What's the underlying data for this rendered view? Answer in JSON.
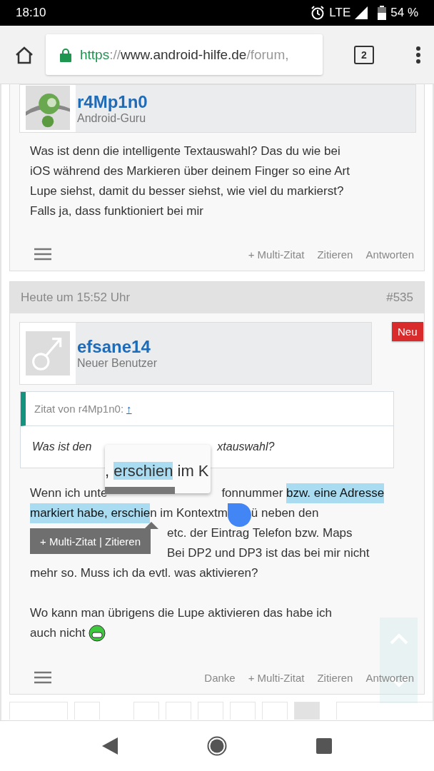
{
  "status_bar": {
    "time": "18:10",
    "network": "LTE",
    "battery": "54 %"
  },
  "browser": {
    "url": {
      "scheme": "https",
      "separator": "://",
      "host": "www.android-hilfe.de",
      "path": "/forum,"
    },
    "tab_count": "2"
  },
  "posts": [
    {
      "author": {
        "name": "r4Mp1n0",
        "rank": "Android-Guru"
      },
      "body": [
        [
          [
            {
              "kind": "text",
              "text": "Was ist denn die intelligente Textauswahl? Das du wie bei",
              "highlighted": false
            }
          ],
          [
            {
              "kind": "text",
              "text": "iOS während des Markieren über deinem Finger so eine Art",
              "highlighted": false
            }
          ],
          [
            {
              "kind": "text",
              "text": "Lupe siehst, damit du besser siehst, wie viel du markierst?",
              "highlighted": false
            }
          ],
          [
            {
              "kind": "text",
              "text": "Falls ja, dass funktioniert bei mir",
              "highlighted": false
            }
          ]
        ]
      ],
      "actions": [
        "+ Multi-Zitat",
        "Zitieren",
        "Antworten"
      ]
    },
    {
      "date": "Heute um 15:52 Uhr",
      "number": "#535",
      "badge": "Neu",
      "author": {
        "name": "efsane14",
        "rank": "Neuer Benutzer"
      },
      "quote": {
        "label": "Zitat von r4Mp1n0:",
        "link": "↑",
        "text": [
          "Was ist den",
          "xtauswahl?"
        ]
      },
      "body": [
        [
          [
            {
              "kind": "text",
              "text": "Wenn ich unte",
              "highlighted": false
            },
            {
              "kind": "lens"
            },
            {
              "kind": "text",
              "text": "fonnummer ",
              "highlighted": false
            },
            {
              "kind": "text",
              "text": "bzw. eine Adresse",
              "highlighted": true
            }
          ],
          [
            {
              "kind": "text",
              "text": "markiert habe, erschie",
              "highlighted": true
            },
            {
              "kind": "text",
              "text": "n im Kontextm",
              "highlighted": false
            },
            {
              "kind": "handle"
            },
            {
              "kind": "text",
              "text": "ü neben den",
              "highlighted": false
            }
          ],
          [
            {
              "kind": "bar"
            },
            {
              "kind": "text",
              "text": "etc. der Eintrag Telefon bzw. Maps",
              "highlighted": false
            }
          ],
          [
            {
              "kind": "bar"
            },
            {
              "kind": "text",
              "text": "Bei DP2 und DP3 ist das bei mir nicht",
              "highlighted": false
            }
          ],
          [
            {
              "kind": "text",
              "text": "mehr so. Muss ich da evtl. was aktivieren?",
              "highlighted": false
            }
          ]
        ],
        [
          [
            {
              "kind": "text",
              "text": "Wo kann man übrigens die Lupe aktivieren das habe ich",
              "highlighted": false
            }
          ],
          [
            {
              "kind": "text",
              "text": "auch nicht",
              "highlighted": false
            },
            {
              "kind": "emoji"
            }
          ]
        ]
      ],
      "actions": [
        "Danke",
        "+ Multi-Zitat",
        "Zitieren",
        "Antworten"
      ]
    }
  ],
  "magnifier": {
    "before": ", ",
    "selected": "erschien",
    "after": " im K"
  },
  "selection_toolbar": "+ Multi-Zitat | Zitieren",
  "pagination": [
    {
      "kind": "wide",
      "selected": false
    },
    {
      "kind": "page",
      "selected": false
    },
    {
      "kind": "page",
      "selected": false
    },
    {
      "kind": "page",
      "selected": false
    },
    {
      "kind": "page",
      "selected": false
    },
    {
      "kind": "page",
      "selected": false
    },
    {
      "kind": "page",
      "selected": false
    },
    {
      "kind": "page",
      "selected": true
    },
    {
      "kind": "wide",
      "selected": false
    }
  ]
}
